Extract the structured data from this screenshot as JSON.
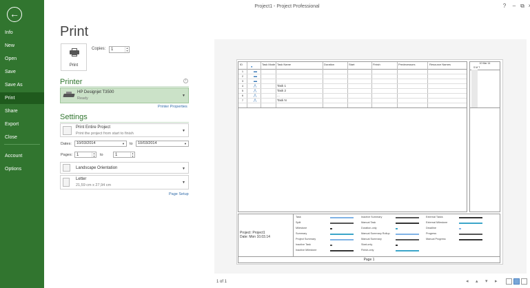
{
  "window": {
    "title": "Project1 - Project Professional",
    "help": "?",
    "minimize": "–",
    "restore": "⧉",
    "close": "×"
  },
  "sidebar": {
    "back_glyph": "←",
    "items": [
      {
        "label": "Info"
      },
      {
        "label": "New"
      },
      {
        "label": "Open"
      },
      {
        "label": "Save"
      },
      {
        "label": "Save As"
      },
      {
        "label": "Print"
      },
      {
        "label": "Share"
      },
      {
        "label": "Export"
      },
      {
        "label": "Close"
      },
      {
        "label": "Account"
      },
      {
        "label": "Options"
      }
    ],
    "active": "Print"
  },
  "print": {
    "title": "Print",
    "button_label": "Print",
    "copies_label": "Copies:",
    "copies_value": "1"
  },
  "printer": {
    "heading": "Printer",
    "name": "HP Designjet T3500",
    "status": "Ready",
    "properties_link": "Printer Properties"
  },
  "settings": {
    "heading": "Settings",
    "range_main": "Print Entire Project",
    "range_sub": "Print the project from start to finish",
    "dates_label": "Dates:",
    "date_from": "10/03/2014",
    "to_label": "to",
    "date_to": "10/03/2014",
    "pages_label": "Pages:",
    "page_from": "1",
    "page_to": "1",
    "orientation": "Landscape Orientation",
    "paper_main": "Letter",
    "paper_sub": "21,59 cm x 27,94 cm",
    "page_setup_link": "Page Setup"
  },
  "preview": {
    "headers": {
      "id": "ID",
      "mode": "Task Mode",
      "name": "Task Name",
      "duration": "Duration",
      "start": "Start",
      "finish": "Finish",
      "pred": "Predecessors",
      "res": "Resource Names",
      "week": "10 Mar 14",
      "days": "S    M    T"
    },
    "rows": [
      {
        "id": "1",
        "name": "",
        "mode": "manual"
      },
      {
        "id": "2",
        "name": "",
        "mode": "manual"
      },
      {
        "id": "3",
        "name": "",
        "mode": "manual"
      },
      {
        "id": "4",
        "name": "Task 1",
        "mode": "auto"
      },
      {
        "id": "5",
        "name": "Task 2",
        "mode": "auto"
      },
      {
        "id": "6",
        "name": "...",
        "mode": "auto"
      },
      {
        "id": "7",
        "name": "Task N",
        "mode": "auto"
      }
    ],
    "project_line1": "Project: Project1",
    "project_line2": "Date: Mon 10.03.14",
    "legend": [
      [
        "Task",
        "Split",
        "Milestone",
        "Summary",
        "Project Summary",
        "Inactive Task",
        "Inactive Milestone"
      ],
      [
        "Inactive Summary",
        "Manual Task",
        "Duration-only",
        "Manual Summary Rollup",
        "Manual Summary",
        "Start-only",
        "Finish-only"
      ],
      [
        "External Tasks",
        "External Milestone",
        "Deadline",
        "Progress",
        "Manual Progress"
      ]
    ],
    "footer": "Page 1"
  },
  "status": {
    "page_count": "1 of 1"
  },
  "colors": {
    "accent": "#31752f",
    "printer_selected": "#cbe2c8",
    "link": "#2f6aa8",
    "task_bar": "#7fb2e5"
  }
}
